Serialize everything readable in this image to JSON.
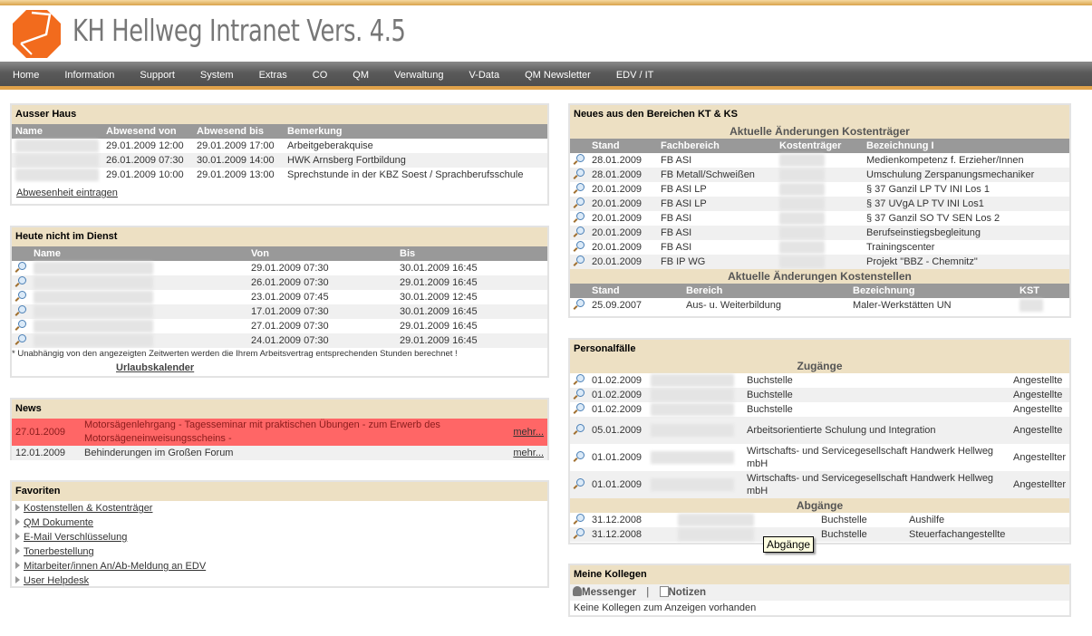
{
  "app": {
    "title": "KH Hellweg Intranet Vers. 4.5"
  },
  "nav": [
    "Home",
    "Information",
    "Support",
    "System",
    "Extras",
    "CO",
    "QM",
    "Verwaltung",
    "V-Data",
    "QM Newsletter",
    "EDV / IT"
  ],
  "ausser_haus": {
    "title": "Ausser Haus",
    "headers": [
      "Name",
      "Abwesend von",
      "Abwesend bis",
      "Bemerkung"
    ],
    "rows": [
      [
        "29.01.2009 12:00",
        "29.01.2009 17:00",
        "Arbeitgeberakquise"
      ],
      [
        "26.01.2009 07:30",
        "30.01.2009 14:00",
        "HWK Arnsberg Fortbildung"
      ],
      [
        "29.01.2009 10:00",
        "29.01.2009 13:00",
        "Sprechstunde in der KBZ Soest / Sprachberufsschule"
      ]
    ],
    "link": "Abwesenheit eintragen"
  },
  "heute": {
    "title": "Heute nicht im Dienst",
    "headers": [
      "Name",
      "Von",
      "Bis"
    ],
    "rows": [
      [
        "29.01.2009 07:30",
        "30.01.2009 16:45"
      ],
      [
        "26.01.2009 07:30",
        "29.01.2009 16:45"
      ],
      [
        "23.01.2009 07:45",
        "30.01.2009 12:45"
      ],
      [
        "17.01.2009 07:30",
        "30.01.2009 16:45"
      ],
      [
        "27.01.2009 07:30",
        "29.01.2009 16:45"
      ],
      [
        "24.01.2009 07:30",
        "29.01.2009 16:45"
      ]
    ],
    "note": "* Unabhängig von den angezeigten Zeitwerten werden die Ihrem Arbeitsvertrag entsprechenden Stunden berechnet !",
    "link": "Urlaubskalender"
  },
  "news": {
    "title": "News",
    "highlight_color": "#ff6666",
    "rows": [
      [
        "27.01.2009",
        "Motorsägenlehrgang - Tagesseminar mit praktischen Übungen - zum Erwerb des Motorsägeneinweisungsscheins -",
        "mehr..."
      ],
      [
        "12.01.2009",
        "Behinderungen im Großen Forum",
        "mehr..."
      ]
    ]
  },
  "favoriten": {
    "title": "Favoriten",
    "items": [
      "Kostenstellen & Kostenträger",
      "QM Dokumente",
      "E-Mail Verschlüsselung",
      "Tonerbestellung",
      "Mitarbeiter/innen An/Ab-Meldung an EDV",
      "User Helpdesk"
    ]
  },
  "kt_ks": {
    "title": "Neues aus den Bereichen KT & KS",
    "kt": {
      "subtitle": "Aktuelle Änderungen Kostenträger",
      "headers": [
        "Stand",
        "Fachbereich",
        "Kostenträger",
        "Bezeichnung I"
      ],
      "rows": [
        [
          "28.01.2009",
          "FB ASI",
          "Medienkompetenz f. Erzieher/Innen"
        ],
        [
          "28.01.2009",
          "FB Metall/Schweißen",
          "Umschulung Zerspanungsmechaniker"
        ],
        [
          "20.01.2009",
          "FB ASI LP",
          "§ 37 Ganzil LP TV INI Los 1"
        ],
        [
          "20.01.2009",
          "FB ASI LP",
          "§ 37 UVgA LP TV INI Los1"
        ],
        [
          "20.01.2009",
          "FB ASI",
          "§ 37 Ganzil SO TV SEN Los 2"
        ],
        [
          "20.01.2009",
          "FB ASI",
          "Berufseinstiegsbegleitung"
        ],
        [
          "20.01.2009",
          "FB ASI",
          "Trainingscenter"
        ],
        [
          "20.01.2009",
          "FB IP WG",
          "Projekt \"BBZ - Chemnitz\""
        ]
      ]
    },
    "ks": {
      "subtitle": "Aktuelle Änderungen Kostenstellen",
      "headers": [
        "Stand",
        "Bereich",
        "Bezeichnung",
        "KST"
      ],
      "rows": [
        [
          "25.09.2007",
          "Aus- u. Weiterbildung",
          "Maler-Werkstätten UN"
        ]
      ]
    }
  },
  "personal": {
    "title": "Personalfälle",
    "zugaenge_title": "Zugänge",
    "zugaenge": [
      [
        "01.02.2009",
        "Buchstelle",
        "Angestellte"
      ],
      [
        "01.02.2009",
        "Buchstelle",
        "Angestellte"
      ],
      [
        "01.02.2009",
        "Buchstelle",
        "Angestellte"
      ],
      [
        "05.01.2009",
        "Arbeitsorientierte Schulung und Integration",
        "Angestellte"
      ],
      [
        "01.01.2009",
        "Wirtschafts- und Servicegesellschaft Handwerk Hellweg mbH",
        "Angestellter"
      ],
      [
        "01.01.2009",
        "Wirtschafts- und Servicegesellschaft Handwerk Hellweg mbH",
        "Angestellter"
      ]
    ],
    "abgaenge_title": "Abgänge",
    "abgaenge": [
      [
        "31.12.2008",
        "Buchstelle",
        "Aushilfe"
      ],
      [
        "31.12.2008",
        "Buchstelle",
        "Steuerfachangestellte"
      ]
    ],
    "tooltip": "Abgänge"
  },
  "kollegen": {
    "title": "Meine Kollegen",
    "messenger": "Messenger",
    "separator": "|",
    "notizen": "Notizen",
    "empty": "Keine Kollegen zum Anzeigen vorhanden"
  }
}
